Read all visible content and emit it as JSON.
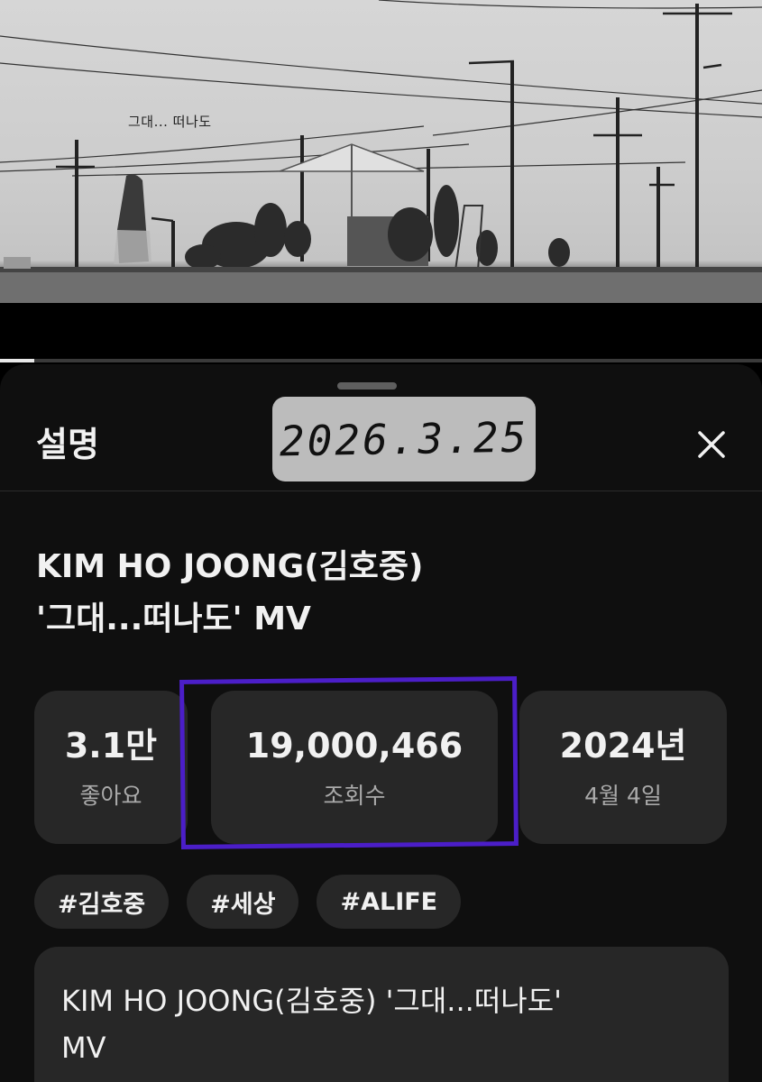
{
  "video": {
    "caption": "그대... 떠나도",
    "progress_percent": 4.5
  },
  "sheet": {
    "title": "설명",
    "date_stamp": "2026.3.25",
    "close_icon": "close-icon"
  },
  "video_title": {
    "line1": "KIM HO JOONG(김호중)",
    "line2": "'그대...떠나도' MV"
  },
  "stats": {
    "likes": {
      "value": "3.1만",
      "label": "좋아요"
    },
    "views": {
      "value": "19,000,466",
      "label": "조회수"
    },
    "date": {
      "value": "2024년",
      "label": "4월 4일"
    }
  },
  "highlight_color": "#4b1ec8",
  "tags": [
    "#김호중",
    "#세상",
    "#ALIFE"
  ],
  "description": {
    "line1": "KIM HO JOONG(김호중) '그대...떠나도'",
    "line2": "MV"
  }
}
